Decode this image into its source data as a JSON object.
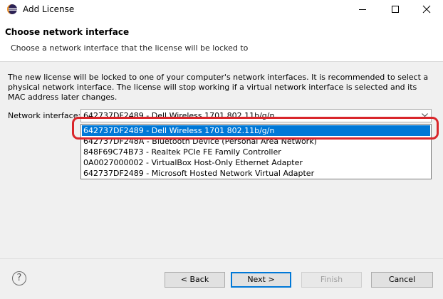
{
  "window": {
    "title": "Add License",
    "icon": "eclipse-icon",
    "controls": [
      "minimize-icon",
      "maximize-icon",
      "close-icon"
    ]
  },
  "banner": {
    "title": "Choose network interface",
    "description": "Choose a network interface that the license will be locked to"
  },
  "main": {
    "info_text": "The new license will be locked to one of your computer's network interfaces. It is recommended to select a physical network interface. The license will stop working if a virtual network interface is selected and its MAC address later changes.",
    "field_label": "Network interface:",
    "selected_value": "642737DF2489 - Dell Wireless 1701 802.11b/g/n",
    "options": [
      "642737DF2489 - Dell Wireless 1701 802.11b/g/n",
      "642737DF248A - Bluetooth Device (Personal Area Network)",
      "848F69C74B73 - Realtek PCIe FE Family Controller",
      "0A0027000002 - VirtualBox Host-Only Ethernet Adapter",
      "642737DF2489 - Microsoft Hosted Network Virtual Adapter"
    ],
    "highlighted_index": 0
  },
  "footer": {
    "help": "?",
    "back": "< Back",
    "next": "Next >",
    "finish": "Finish",
    "cancel": "Cancel"
  },
  "colors": {
    "selection": "#0078d7",
    "annotation": "#d9262b"
  }
}
